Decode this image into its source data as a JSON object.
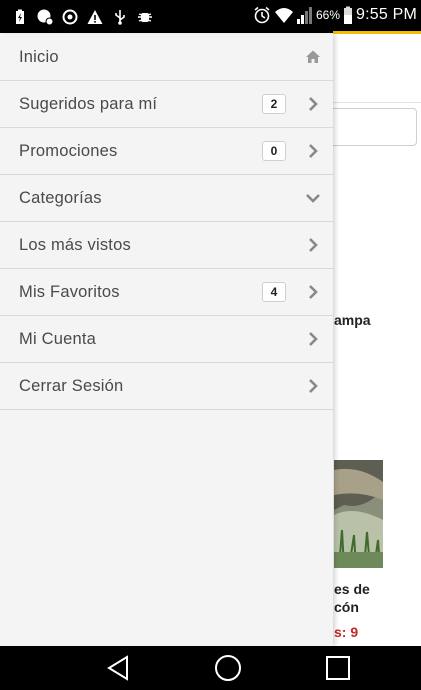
{
  "status_bar": {
    "battery_percent": "66%",
    "time": "9:55 PM",
    "icons": [
      "battery-charging-icon",
      "hangouts-icon",
      "broadcast-icon",
      "warning-icon",
      "usb-icon",
      "android-debug-icon",
      "alarm-icon",
      "wifi-icon",
      "signal-icon",
      "battery-icon"
    ]
  },
  "background_page": {
    "text1": "ampa",
    "text2": "es de\ncón",
    "text3": "s: 9",
    "accent_color": "#f0c000",
    "price_color": "#c62828"
  },
  "drawer": {
    "items": [
      {
        "label": "Inicio",
        "icon": "home-icon",
        "badge": null
      },
      {
        "label": "Sugeridos para mí",
        "icon": "chevron-right-icon",
        "badge": "2"
      },
      {
        "label": "Promociones",
        "icon": "chevron-right-icon",
        "badge": "0"
      },
      {
        "label": "Categorías",
        "icon": "chevron-down-icon",
        "badge": null
      },
      {
        "label": "Los más vistos",
        "icon": "chevron-right-icon",
        "badge": null
      },
      {
        "label": "Mis Favoritos",
        "icon": "chevron-right-icon",
        "badge": "4"
      },
      {
        "label": "Mi Cuenta",
        "icon": "chevron-right-icon",
        "badge": null
      },
      {
        "label": "Cerrar Sesión",
        "icon": "chevron-right-icon",
        "badge": null
      }
    ]
  },
  "nav_bar": {
    "buttons": [
      "back-icon",
      "home-circle-icon",
      "recents-icon"
    ]
  }
}
